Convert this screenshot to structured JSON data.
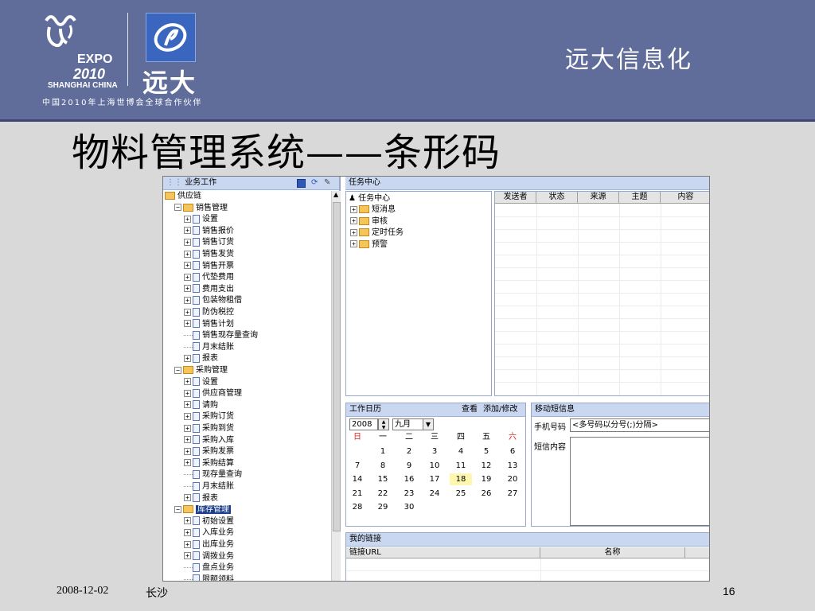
{
  "header": {
    "expo_text": "EXPO",
    "expo_year": "2010",
    "expo_city": "SHANGHAI CHINA",
    "yd_logo_text": "远大",
    "partner_text": "中国2010年上海世博会全球合作伙伴",
    "brand_text": "远大信息化"
  },
  "slide_title": "物料管理系统——条形码",
  "app": {
    "left_panel_title": "业务工作",
    "tree": [
      {
        "label": "供应链",
        "type": "folder-open",
        "expander": false
      },
      {
        "label": "销售管理",
        "type": "folder",
        "expander": true
      },
      {
        "label": "设置",
        "type": "item",
        "expander": true
      },
      {
        "label": "销售报价",
        "type": "item",
        "expander": true
      },
      {
        "label": "销售订货",
        "type": "item",
        "expander": true
      },
      {
        "label": "销售发货",
        "type": "item",
        "expander": true
      },
      {
        "label": "销售开票",
        "type": "item",
        "expander": true
      },
      {
        "label": "代垫费用",
        "type": "item",
        "expander": true
      },
      {
        "label": "费用支出",
        "type": "item",
        "expander": true
      },
      {
        "label": "包装物租借",
        "type": "item",
        "expander": true
      },
      {
        "label": "防伪税控",
        "type": "item",
        "expander": true
      },
      {
        "label": "销售计划",
        "type": "item",
        "expander": true
      },
      {
        "label": "销售现存量查询",
        "type": "item",
        "expander": false
      },
      {
        "label": "月末结账",
        "type": "item",
        "expander": false
      },
      {
        "label": "报表",
        "type": "item",
        "expander": true
      },
      {
        "label": "采购管理",
        "type": "folder",
        "expander": true
      },
      {
        "label": "设置",
        "type": "item",
        "expander": true
      },
      {
        "label": "供应商管理",
        "type": "item",
        "expander": true
      },
      {
        "label": "请购",
        "type": "item",
        "expander": true
      },
      {
        "label": "采购订货",
        "type": "item",
        "expander": true
      },
      {
        "label": "采购到货",
        "type": "item",
        "expander": true
      },
      {
        "label": "采购入库",
        "type": "item",
        "expander": true
      },
      {
        "label": "采购发票",
        "type": "item",
        "expander": true
      },
      {
        "label": "采购结算",
        "type": "item",
        "expander": true
      },
      {
        "label": "现存量查询",
        "type": "item",
        "expander": false
      },
      {
        "label": "月末结账",
        "type": "item",
        "expander": false
      },
      {
        "label": "报表",
        "type": "item",
        "expander": true
      },
      {
        "label": "库存管理",
        "type": "folder",
        "expander": true,
        "selected": true
      },
      {
        "label": "初始设置",
        "type": "item",
        "expander": true
      },
      {
        "label": "入库业务",
        "type": "item",
        "expander": true
      },
      {
        "label": "出库业务",
        "type": "item",
        "expander": true
      },
      {
        "label": "调拨业务",
        "type": "item",
        "expander": true
      },
      {
        "label": "盘点业务",
        "type": "item",
        "expander": false
      },
      {
        "label": "限额领料",
        "type": "item",
        "expander": false
      }
    ],
    "task_center": {
      "title": "任务中心",
      "root": "任务中心",
      "children": [
        "短消息",
        "审核",
        "定时任务",
        "预警"
      ]
    },
    "task_grid_columns": [
      "发送者",
      "状态",
      "来源",
      "主题",
      "内容"
    ],
    "calendar": {
      "title": "工作日历",
      "view_link": "查看",
      "add_link": "添加/修改",
      "year": "2008",
      "month": "九月",
      "weekdays": [
        "日",
        "一",
        "二",
        "三",
        "四",
        "五",
        "六"
      ],
      "weeks": [
        [
          "",
          "1",
          "2",
          "3",
          "4",
          "5",
          "6"
        ],
        [
          "7",
          "8",
          "9",
          "10",
          "11",
          "12",
          "13"
        ],
        [
          "14",
          "15",
          "16",
          "17",
          "18",
          "19",
          "20"
        ],
        [
          "21",
          "22",
          "23",
          "24",
          "25",
          "26",
          "27"
        ],
        [
          "28",
          "29",
          "30",
          "",
          "",
          "",
          ""
        ]
      ],
      "highlighted_day": "18"
    },
    "sms": {
      "title": "移动短信息",
      "phone_label": "手机号码",
      "phone_placeholder": "<多号码以分号(;)分隔>",
      "content_label": "短信内容"
    },
    "links": {
      "title": "我的链接",
      "columns": [
        "链接URL",
        "名称"
      ]
    }
  },
  "footer": {
    "date": "2008-12-02",
    "city": "长沙",
    "page": "16"
  },
  "colors": {
    "header_bg": "#606d9b",
    "slide_bg": "#d9d9d9",
    "panel_header": "#c9d7f1",
    "weekend_red": "#d9261c",
    "highlight_yellow": "#fff6b0",
    "tree_selected": "#1d3f8c"
  }
}
